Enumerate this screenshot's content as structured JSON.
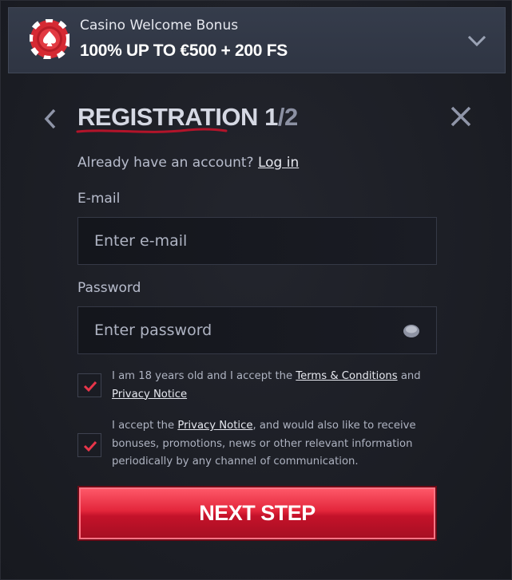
{
  "bonus": {
    "subtitle": "Casino Welcome Bonus",
    "title": "100% UP TO €500 + 200 FS"
  },
  "heading": {
    "title": "REGISTRATION",
    "step_current": "1",
    "step_separator": "/",
    "step_total": "2"
  },
  "account": {
    "prompt": "Already have an account?",
    "login_link": "Log in"
  },
  "email": {
    "label": "E-mail",
    "placeholder": "Enter e-mail",
    "value": ""
  },
  "password": {
    "label": "Password",
    "placeholder": "Enter password",
    "value": ""
  },
  "consent_age": {
    "checked": true,
    "text_before": "I am 18 years old and I accept the",
    "terms_link": "Terms & Conditions",
    "text_and": "and",
    "privacy_link": "Privacy Notice"
  },
  "consent_marketing": {
    "checked": true,
    "text_before": "I accept the",
    "privacy_link": "Privacy Notice",
    "text_after": ", and would also like to receive bonuses, promotions, news or other relevant information periodically by any channel of communication."
  },
  "next_button": {
    "label": "NEXT STEP"
  },
  "colors": {
    "accent": "#e3263b",
    "panel": "#1c1e25",
    "header": "#323845"
  },
  "icons": {
    "chip": "casino-chip-icon",
    "expand": "chevron-down-icon",
    "back": "chevron-left-icon",
    "close": "close-icon",
    "eye": "eye-icon",
    "check": "checkmark-icon"
  }
}
